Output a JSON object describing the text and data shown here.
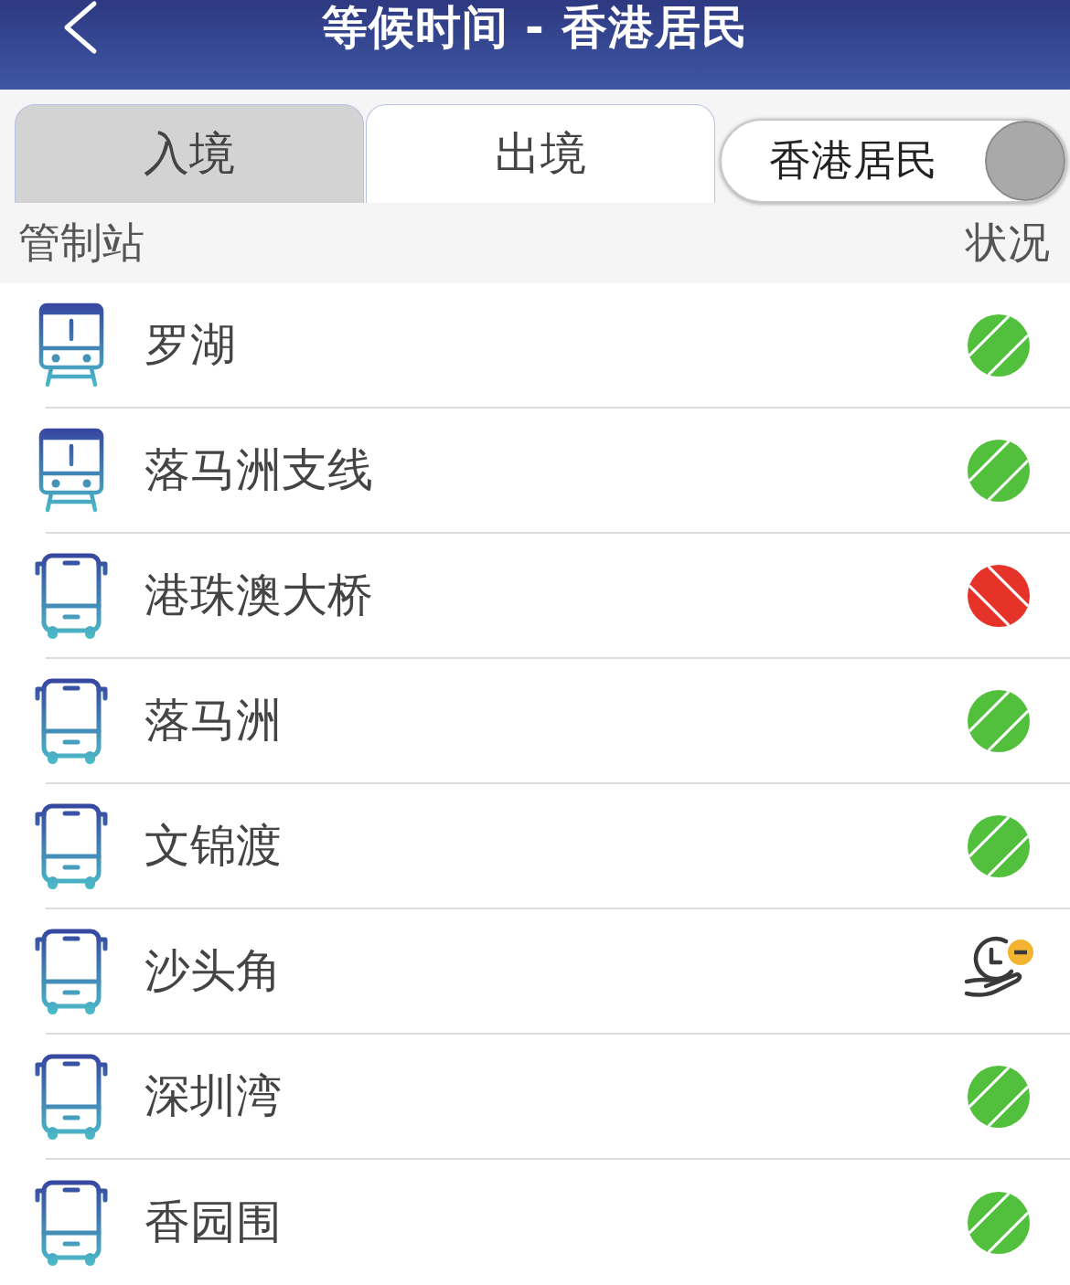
{
  "header": {
    "title": "等候时间 - 香港居民"
  },
  "tabs": [
    {
      "label": "入境",
      "selected": false
    },
    {
      "label": "出境",
      "selected": true
    }
  ],
  "toggle": {
    "label": "香港居民",
    "on": true
  },
  "columns": [
    "管制站",
    "状况"
  ],
  "rows": [
    {
      "kind": "train",
      "name": "罗湖",
      "status": {
        "kind": "rising",
        "color": "#52c03c"
      }
    },
    {
      "kind": "train",
      "name": "落马洲支线",
      "status": {
        "kind": "rising",
        "color": "#52c03c"
      }
    },
    {
      "kind": "bus",
      "name": "港珠澳大桥",
      "status": {
        "kind": "falling",
        "color": "#e6332a"
      }
    },
    {
      "kind": "bus",
      "name": "落马洲",
      "status": {
        "kind": "rising",
        "color": "#52c03c"
      }
    },
    {
      "kind": "bus",
      "name": "文锦渡",
      "status": {
        "kind": "rising",
        "color": "#52c03c"
      }
    },
    {
      "kind": "bus",
      "name": "沙头角",
      "status": {
        "kind": "clock"
      }
    },
    {
      "kind": "bus",
      "name": "深圳湾",
      "status": {
        "kind": "rising",
        "color": "#52c03c"
      }
    },
    {
      "kind": "bus",
      "name": "香园围",
      "status": {
        "kind": "rising",
        "color": "#52c03c"
      }
    }
  ]
}
